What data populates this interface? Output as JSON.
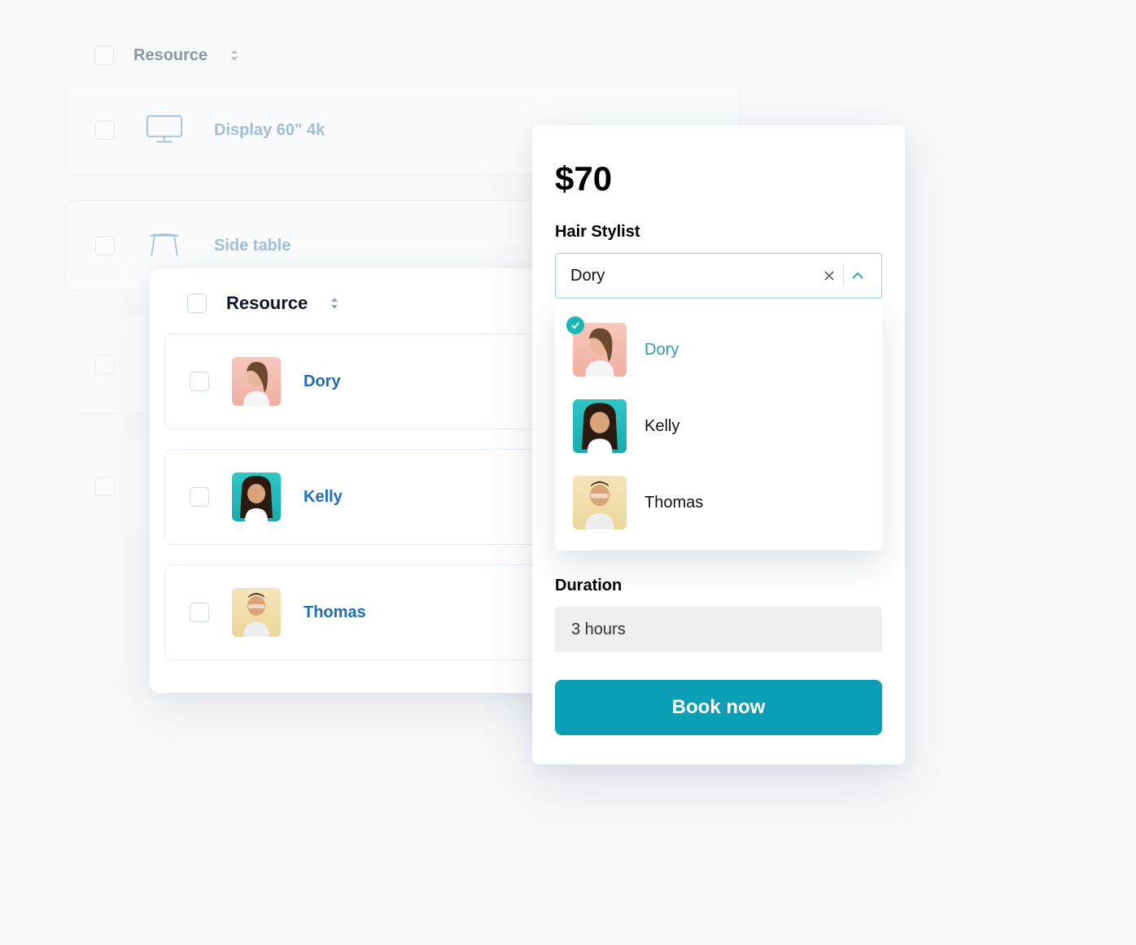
{
  "back_list": {
    "header": "Resource",
    "items": [
      {
        "label": "Display 60\" 4k",
        "icon": "monitor"
      },
      {
        "label": "Side table",
        "icon": "table"
      }
    ]
  },
  "mid_list": {
    "header": "Resource",
    "items": [
      {
        "name": "Dory",
        "avatar": "dory"
      },
      {
        "name": "Kelly",
        "avatar": "kelly"
      },
      {
        "name": "Thomas",
        "avatar": "thomas"
      }
    ]
  },
  "booking": {
    "price": "$70",
    "stylist_label": "Hair Stylist",
    "selected_stylist": "Dory",
    "options": [
      {
        "name": "Dory",
        "avatar": "dory",
        "selected": true
      },
      {
        "name": "Kelly",
        "avatar": "kelly",
        "selected": false
      },
      {
        "name": "Thomas",
        "avatar": "thomas",
        "selected": false
      }
    ],
    "duration_label": "Duration",
    "duration_value": "3 hours",
    "book_button": "Book now"
  }
}
